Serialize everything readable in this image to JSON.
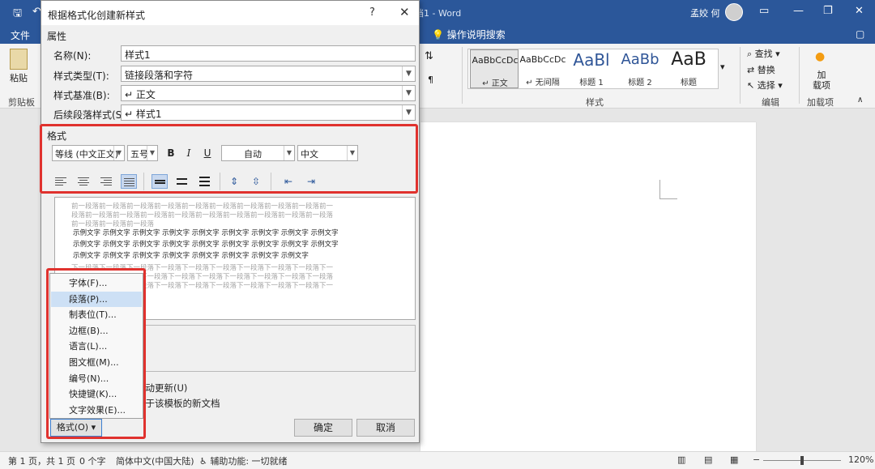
{
  "app": {
    "doc_title": "档1 - Word",
    "user_name": "孟姣 何",
    "tabs": [
      "文件"
    ],
    "tell_me": "操作说明搜索"
  },
  "ribbon": {
    "paste_label": "粘贴",
    "clipboard_group": "剪贴板",
    "styles_group": "样式",
    "editing_group": "编辑",
    "addins_group": "加载项",
    "find_label": "查找",
    "replace_label": "替换",
    "select_label": "选择",
    "addins_label": "加\n载项",
    "styles": [
      {
        "preview": "AaBbCcDc",
        "name": "↵ 正文",
        "selected": true
      },
      {
        "preview": "AaBbCcDc",
        "name": "↵ 无间隔",
        "selected": false
      },
      {
        "preview": "AaBl",
        "name": "标题 1",
        "selected": false
      },
      {
        "preview": "AaBb",
        "name": "标题 2",
        "selected": false
      },
      {
        "preview": "AaB",
        "name": "标题",
        "selected": false
      }
    ]
  },
  "dialog": {
    "title": "根据格式化创建新样式",
    "help": "?",
    "properties_heading": "属性",
    "props": [
      {
        "label": "名称(N):",
        "value": "样式1",
        "dropdown": false
      },
      {
        "label": "样式类型(T):",
        "value": "链接段落和字符",
        "dropdown": true
      },
      {
        "label": "样式基准(B):",
        "value": "↵ 正文",
        "dropdown": true
      },
      {
        "label": "后续段落样式(S):",
        "value": "↵ 样式1",
        "dropdown": true
      }
    ],
    "format_heading": "格式",
    "font_name": "等线 (中文正文)",
    "font_size": "五号",
    "bold": "B",
    "italic": "I",
    "underline": "U",
    "color": "自动",
    "language": "中文",
    "preview": {
      "prev_para": [
        "前一段落前一段落前一段落前一段落前一段落前一段落前一段落前一段落前一段落前一",
        "段落前一段落前一段落前一段落前一段落前一段落前一段落前一段落前一段落前一段落",
        "前一段落前一段落前一段落"
      ],
      "sample": [
        "示例文字  示例文字  示例文字  示例文字  示例文字  示例文字  示例文字  示例文字  示例文字",
        "示例文字  示例文字  示例文字  示例文字  示例文字  示例文字  示例文字  示例文字  示例文字",
        "示例文字  示例文字  示例文字  示例文字  示例文字  示例文字  示例文字  示例文字"
      ],
      "next_para": [
        "下一段落下一段落下一段落下一段落下一段落下一段落下一段落下一段落下一段落下一",
        "段落下一段落下一段落下一段落下一段落下一段落下一段落下一段落下一段落下一段落",
        "下一段落下一段落下一段落下一段落下一段落下一段落下一段落下一段落下一段落下一"
      ]
    },
    "auto_update": "自动更新(U)",
    "new_docs": "基于该模板的新文档",
    "ok": "确定",
    "cancel": "取消",
    "format_button": "格式(O) ▾"
  },
  "format_menu": [
    {
      "label": "字体(F)...",
      "selected": false
    },
    {
      "label": "段落(P)...",
      "selected": true
    },
    {
      "label": "制表位(T)...",
      "selected": false
    },
    {
      "label": "边框(B)...",
      "selected": false
    },
    {
      "label": "语言(L)...",
      "selected": false
    },
    {
      "label": "图文框(M)...",
      "selected": false
    },
    {
      "label": "编号(N)...",
      "selected": false
    },
    {
      "label": "快捷键(K)...",
      "selected": false
    },
    {
      "label": "文字效果(E)...",
      "selected": false
    }
  ],
  "statusbar": {
    "page": "第 1 页，共 1 页",
    "words": "0 个字",
    "language": "简体中文(中国大陆)",
    "accessibility": "辅助功能: 一切就绪",
    "zoom": "120%",
    "zoom_level": 0.5
  },
  "colors": {
    "title_blue": "#2b579a",
    "highlight_red": "#e0322e",
    "menu_select": "#cde0f5"
  }
}
